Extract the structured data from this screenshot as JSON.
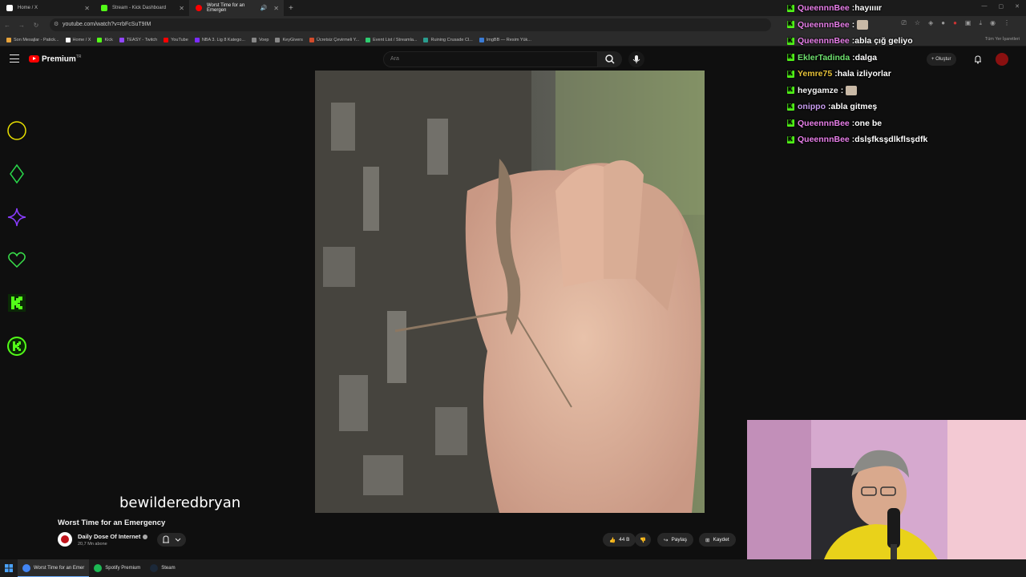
{
  "browser": {
    "tabs": [
      {
        "label": "Home / X",
        "icon": "x-icon",
        "color": "#ffffff"
      },
      {
        "label": "Stream - Kick Dashboard",
        "icon": "kick-icon",
        "color": "#53fc18"
      },
      {
        "label": "Worst Time for an Emergen",
        "icon": "youtube-icon",
        "color": "#ff0000",
        "active": true
      }
    ],
    "url": "youtube.com/watch?v=rbFcSuT9IM",
    "bookmarks": [
      {
        "label": "Son Mesajlar - Patick...",
        "color": "#e8a33a"
      },
      {
        "label": "Home / X",
        "color": "#ffffff"
      },
      {
        "label": "Kick",
        "color": "#53fc18"
      },
      {
        "label": "TEASY - Twitch",
        "color": "#9146ff"
      },
      {
        "label": "YouTube",
        "color": "#ff0000"
      },
      {
        "label": "NBA 3. Lig 8 Katego...",
        "color": "#7b2cff"
      },
      {
        "label": "Voep",
        "color": "#888888"
      },
      {
        "label": "KeyGivers",
        "color": "#888888"
      },
      {
        "label": "Ücretsiz Çevirmeli Y...",
        "color": "#d24b2b"
      },
      {
        "label": "Event List / Streamla...",
        "color": "#2ecc71"
      },
      {
        "label": "Ruining Crusade Cl...",
        "color": "#2a9d8f"
      },
      {
        "label": "ImgBB — Resim Yük...",
        "color": "#3a7bd5"
      }
    ],
    "bookmarks_right": "Tüm Yer İşaretleri"
  },
  "youtube": {
    "brand": "Premium",
    "brand_sup": "TR",
    "search_placeholder": "Ara",
    "create_label": "Oluştur"
  },
  "video": {
    "title": "Worst Time for an Emergency",
    "channel": "Daily Dose Of Internet",
    "subscribers": "20,7 Mn abone",
    "likes": "44 B",
    "share_label": "Paylaş",
    "save_label": "Kaydet",
    "overlay_username": "bewilderedbryan"
  },
  "chat": [
    {
      "user": "QueennnBee",
      "text": "hayıııır",
      "color": "#e77ee8"
    },
    {
      "user": "QueennnBee",
      "text": "",
      "color": "#e77ee8",
      "emote": true
    },
    {
      "user": "QueennnBee",
      "text": "abla çığ geliyo",
      "color": "#e77ee8"
    },
    {
      "user": "EklerTadinda",
      "text": "dalga",
      "color": "#6ee06e"
    },
    {
      "user": "Yemre75",
      "text": "hala izliyorlar",
      "color": "#e6c23a"
    },
    {
      "user": "heygamze",
      "text": "",
      "color": "#f2f2f2",
      "emote": true
    },
    {
      "user": "onippo",
      "text": "abla gitmeş",
      "color": "#c89cf0"
    },
    {
      "user": "QueennnBee",
      "text": "one be",
      "color": "#e77ee8"
    },
    {
      "user": "QueennnBee",
      "text": "dslşfksşdlkflsşdfk",
      "color": "#e77ee8"
    }
  ],
  "taskbar": [
    {
      "label": "Worst Time for an Emer",
      "icon": "chrome-icon",
      "color": "#4285f4",
      "active": true
    },
    {
      "label": "Spotify Premium",
      "icon": "spotify-icon",
      "color": "#1db954"
    },
    {
      "label": "Steam",
      "icon": "steam-icon",
      "color": "#1b2838"
    }
  ],
  "side_icons": [
    {
      "name": "circle-icon",
      "color": "#e8e000"
    },
    {
      "name": "diamond-icon",
      "color": "#29d64a"
    },
    {
      "name": "sparkle-icon",
      "color": "#8a3cff"
    },
    {
      "name": "heart-icon",
      "color": "#39e04a"
    },
    {
      "name": "kick-logo-icon",
      "color": "#53fc18"
    },
    {
      "name": "kick-circle-icon",
      "color": "#53fc18"
    }
  ]
}
